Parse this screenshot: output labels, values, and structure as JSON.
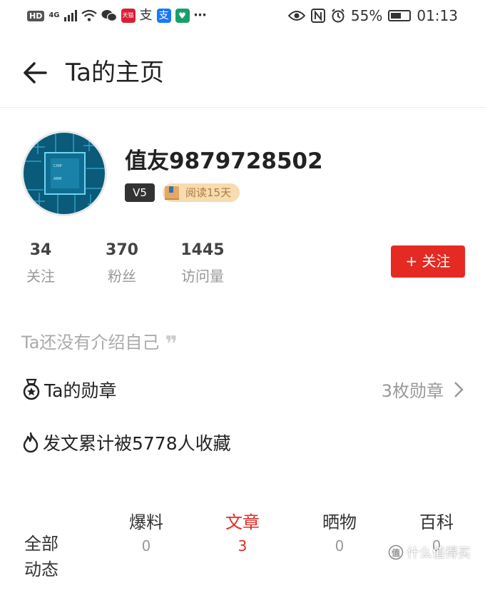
{
  "status_bar": {
    "network": "4G",
    "battery": "55%",
    "battery_level": 0.55,
    "time": "01:13",
    "tmall_badge": "天猫",
    "alipay_glyph": "支"
  },
  "header": {
    "title": "Ta的主页"
  },
  "profile": {
    "username": "值友9879728502",
    "level": "V5",
    "reading_badge": "阅读15天"
  },
  "stats": [
    {
      "value": "34",
      "label": "关注"
    },
    {
      "value": "370",
      "label": "粉丝"
    },
    {
      "value": "1445",
      "label": "访问量"
    }
  ],
  "follow_button": "+ 关注",
  "intro": "Ta还没有介绍自己",
  "medals": {
    "label": "Ta的勋章",
    "count": "3枚勋章"
  },
  "favorites": "发文累计被5778人收藏",
  "tabs": [
    {
      "label": "全部\n动态",
      "count": ""
    },
    {
      "label": "爆料",
      "count": "0"
    },
    {
      "label": "文章",
      "count": "3"
    },
    {
      "label": "晒物",
      "count": "0"
    },
    {
      "label": "百科",
      "count": "0"
    }
  ],
  "watermark": "什么值得买",
  "colors": {
    "accent": "#e42a22",
    "badge_bg": "#f6dcb0"
  }
}
